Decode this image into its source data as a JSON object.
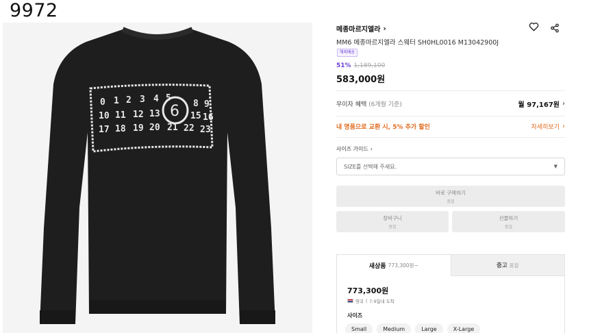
{
  "corner_label": "9972",
  "brand": {
    "name": "메종마르지엘라"
  },
  "product": {
    "name": "MM6 메종마르지엘라 스웨터 SH0HL0016 M13042900J",
    "badge": "해외배송",
    "discount": "51%",
    "original_price": "1,189,100",
    "price": "583,000원"
  },
  "installment": {
    "label": "무이자 혜택",
    "sub": "(6개월 기준)",
    "value": "월 97,167원"
  },
  "promo": {
    "label": "내 명품으로 교환 시, 5% 추가 할인",
    "link": "자세히보기"
  },
  "size_guide": "사이즈 가이드",
  "size_select": {
    "placeholder": "SIZE를 선택해 주세요."
  },
  "buttons": {
    "buy": {
      "label": "바로 구매하기",
      "sub": "품절"
    },
    "cart": {
      "label": "장바구니",
      "sub": "품절"
    },
    "gift": {
      "label": "선물하기",
      "sub": "품절"
    }
  },
  "tabs": [
    {
      "label": "새상품",
      "sub": "773,300원~"
    },
    {
      "label": "중고",
      "sub": "품절"
    }
  ],
  "offer": {
    "price": "773,300원",
    "origin": "영국",
    "delivery": "7-9일내 도착",
    "size_label": "사이즈",
    "sizes": [
      "Small",
      "Medium",
      "Large",
      "X-Large"
    ]
  },
  "icons": {
    "brand_chevron": "chevron-right-icon",
    "heart": "heart-icon",
    "share": "share-icon",
    "select_caret": "caret-down-icon"
  },
  "colors": {
    "accent_purple": "#6b3fd6",
    "promo_orange": "#e06b1f",
    "sweater": "#1e1e1e"
  }
}
